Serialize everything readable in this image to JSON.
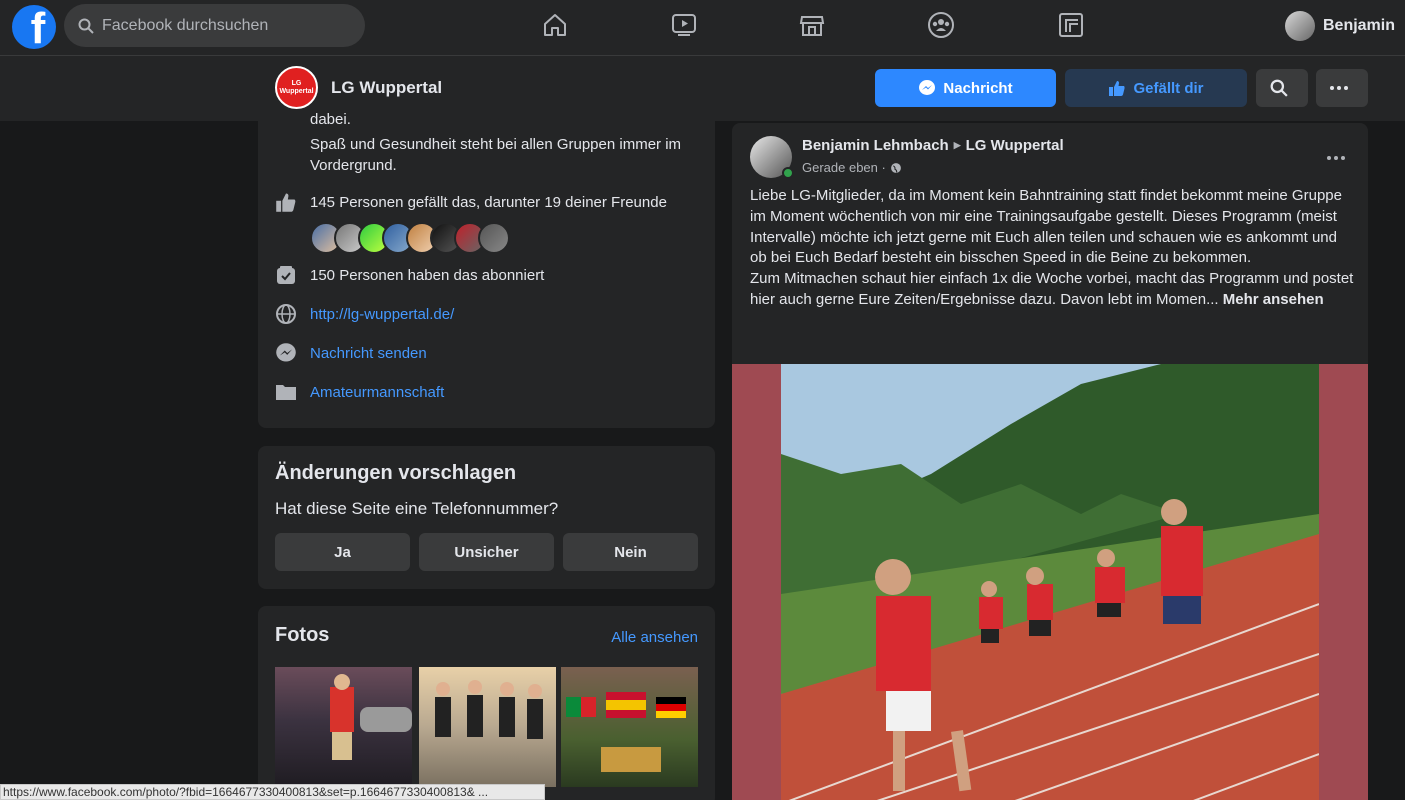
{
  "topbar": {
    "logo": "f",
    "search_placeholder": "Facebook durchsuchen",
    "nav_icons": [
      "home-icon",
      "watch-icon",
      "marketplace-icon",
      "groups-icon",
      "gaming-icon"
    ],
    "user_name": "Benjamin"
  },
  "page": {
    "logo_text": "LG Wuppertal",
    "name": "LG Wuppertal",
    "message_label": "Nachricht",
    "like_label": "Gefällt dir"
  },
  "about": {
    "desc_partial": "dabei.",
    "desc": "Spaß und Gesundheit steht bei allen Gruppen immer im Vordergrund.",
    "likes": "145 Personen gefällt das, darunter 19 deiner Freunde",
    "follows": "150 Personen haben das abonniert",
    "website": "http://lg-wuppertal.de/",
    "send_message": "Nachricht senden",
    "category": "Amateurmannschaft"
  },
  "suggest": {
    "title": "Änderungen vorschlagen",
    "question": "Hat diese Seite eine Telefonnummer?",
    "yes": "Ja",
    "unsure": "Unsicher",
    "no": "Nein"
  },
  "photos": {
    "title": "Fotos",
    "see_all": "Alle ansehen"
  },
  "statusbar": "https://www.facebook.com/photo/?fbid=1664677330400813&set=p.1664677330400813&  ...",
  "post": {
    "author": "Benjamin Lehmbach",
    "target": "LG Wuppertal",
    "time": "Gerade eben ·",
    "body": "Liebe LG-Mitglieder, da im Moment kein Bahntraining statt findet bekommt meine Gruppe im Moment wöchentlich von mir eine Trainingsaufgabe gestellt. Dieses Programm (meist Intervalle) möchte ich jetzt gerne mit Euch allen teilen und schauen wie es ankommt und ob bei Euch Bedarf besteht ein bisschen Speed in die Beine zu bekommen.",
    "body2": "Zum Mitmachen schaut hier einfach 1x die Woche vorbei, macht das Programm und postet hier auch gerne Eure Zeiten/Ergebnisse dazu. Davon lebt im Momen...",
    "more": "Mehr ansehen"
  }
}
